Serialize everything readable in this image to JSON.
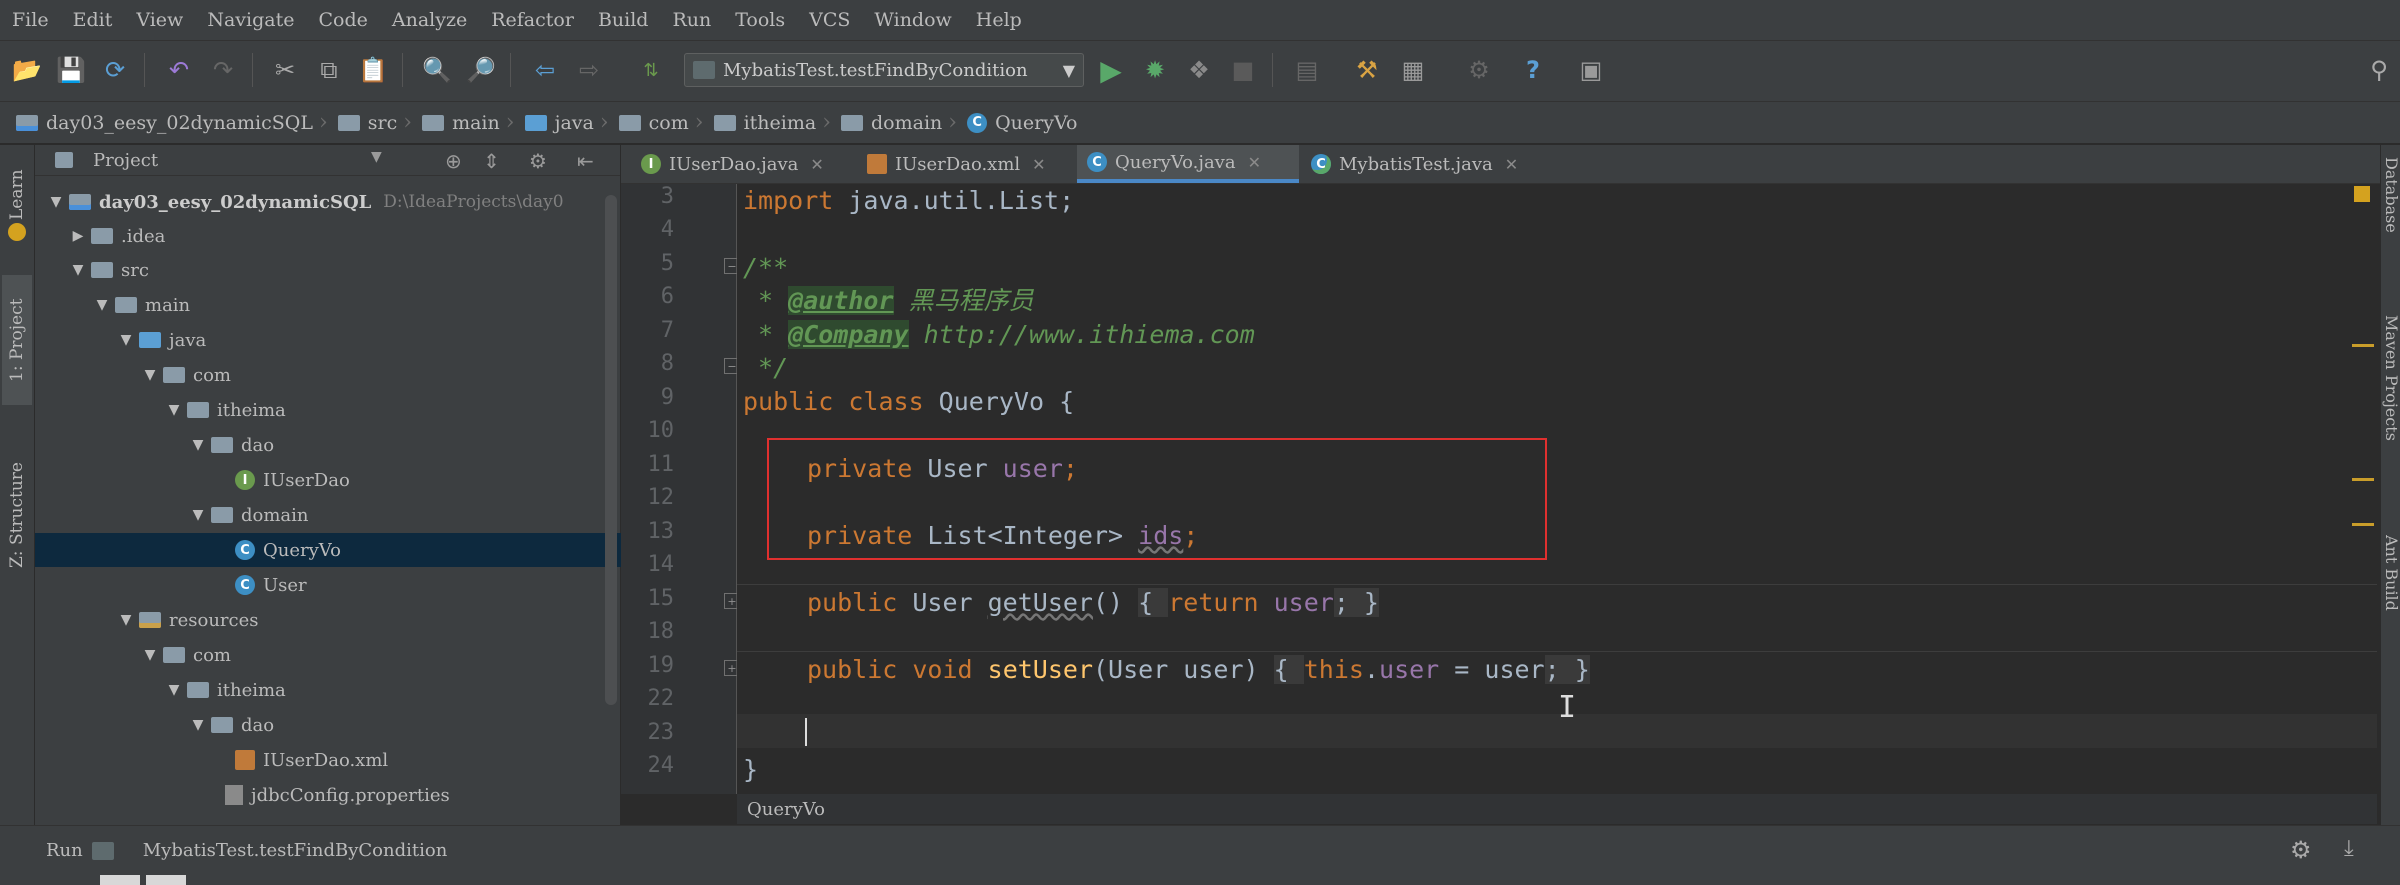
{
  "menu": [
    "File",
    "Edit",
    "View",
    "Navigate",
    "Code",
    "Analyze",
    "Refactor",
    "Build",
    "Run",
    "Tools",
    "VCS",
    "Window",
    "Help"
  ],
  "toolbar": {
    "run_config": "MybatisTest.testFindByCondition"
  },
  "breadcrumb": [
    "day03_eesy_02dynamicSQL",
    "src",
    "main",
    "java",
    "com",
    "itheima",
    "domain",
    "QueryVo"
  ],
  "left_strip": {
    "learn": "Learn",
    "project": "1: Project",
    "structure": "Z: Structure"
  },
  "project": {
    "title": "Project",
    "tree": [
      {
        "label": "day03_eesy_02dynamicSQL",
        "path": "D:\\IdeaProjects\\day0"
      },
      {
        "label": ".idea"
      },
      {
        "label": "src"
      },
      {
        "label": "main"
      },
      {
        "label": "java"
      },
      {
        "label": "com"
      },
      {
        "label": "itheima"
      },
      {
        "label": "dao"
      },
      {
        "label": "IUserDao"
      },
      {
        "label": "domain"
      },
      {
        "label": "QueryVo"
      },
      {
        "label": "User"
      },
      {
        "label": "resources"
      },
      {
        "label": "com"
      },
      {
        "label": "itheima"
      },
      {
        "label": "dao"
      },
      {
        "label": "IUserDao.xml"
      },
      {
        "label": "jdbcConfig.properties"
      }
    ]
  },
  "tabs": [
    "IUserDao.java",
    "IUserDao.xml",
    "QueryVo.java",
    "MybatisTest.java"
  ],
  "line_numbers": [
    "3",
    "4",
    "5",
    "6",
    "7",
    "8",
    "9",
    "10",
    "11",
    "12",
    "13",
    "14",
    "15",
    "18",
    "19",
    "22",
    "23",
    "24"
  ],
  "code": {
    "l3": {
      "import": "import",
      "rest": " java.util.List;"
    },
    "l5": "/**",
    "l6": {
      "star": " * ",
      "tag": "@author",
      "text": " 黑马程序员"
    },
    "l7": {
      "star": " * ",
      "tag": "@Company",
      "text": " http://www.ithiema.com"
    },
    "l8": " */",
    "l9": {
      "kw": "public class",
      "rest": " QueryVo {"
    },
    "l11": {
      "kw": "private",
      "type": " User ",
      "field": "user",
      "end": ";"
    },
    "l13": {
      "kw": "private",
      "type": " List<Integer> ",
      "field": "ids",
      "end": ";"
    },
    "l15": {
      "kw": "public",
      "type": " User ",
      "fn": "getUser",
      "args": "() ",
      "open": "{ ",
      "ret": "return",
      "field": " user",
      "close": "; }"
    },
    "l19": {
      "kw": "public void",
      "sp": " ",
      "fn": "setUser",
      "args": "(User user) ",
      "open": "{ ",
      "this": "this",
      "dot": ".",
      "field": "user",
      "assign": " = user",
      "close": "; }"
    },
    "l24": "}"
  },
  "editor_breadcrumb": "QueryVo",
  "right_strip": {
    "database": "Database",
    "maven": "Maven Projects",
    "ant": "Ant Build"
  },
  "run_bar": {
    "label": "Run",
    "config": "MybatisTest.testFindByCondition"
  }
}
